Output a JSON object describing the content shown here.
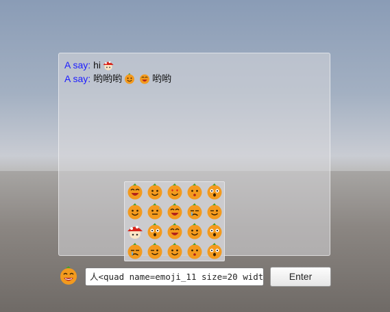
{
  "chat": {
    "messages": [
      {
        "speaker": "A say:",
        "parts": [
          {
            "type": "text",
            "value": "hi"
          },
          {
            "type": "emoji",
            "icon": "red-mushroom-emoji"
          }
        ]
      },
      {
        "speaker": "A say:",
        "parts": [
          {
            "type": "text",
            "value": "哟哟哟"
          },
          {
            "type": "emoji",
            "icon": "orange-smile-emoji"
          },
          {
            "type": "emoji",
            "icon": "orange-laugh-emoji"
          },
          {
            "type": "text",
            "value": "哟哟"
          }
        ]
      }
    ]
  },
  "emoji_picker": {
    "icons": [
      "orange-grin-emoji",
      "orange-happy-emoji",
      "orange-heart-eyes-emoji",
      "orange-kiss-emoji",
      "orange-surprised-emoji",
      "orange-smile-emoji",
      "orange-sweat-emoji",
      "orange-laugh-emoji",
      "orange-cry-emoji",
      "orange-wink-emoji",
      "red-mushroom-emoji",
      "orange-angry-emoji",
      "orange-cool-emoji",
      "orange-tongue-emoji",
      "orange-shock-emoji",
      "orange-sleepy-emoji",
      "orange-sly-emoji",
      "orange-shy-emoji",
      "orange-peek-emoji",
      "orange-confused-emoji"
    ]
  },
  "input": {
    "emoji_button_icon": "orange-grin-emoji",
    "value": "人<quad name=emoji_11 size=20 widt",
    "enter_label": "Enter"
  },
  "colors": {
    "speaker": "#1a1aff",
    "emoji_orange": "#f39a1e",
    "emoji_red": "#d9261c"
  }
}
